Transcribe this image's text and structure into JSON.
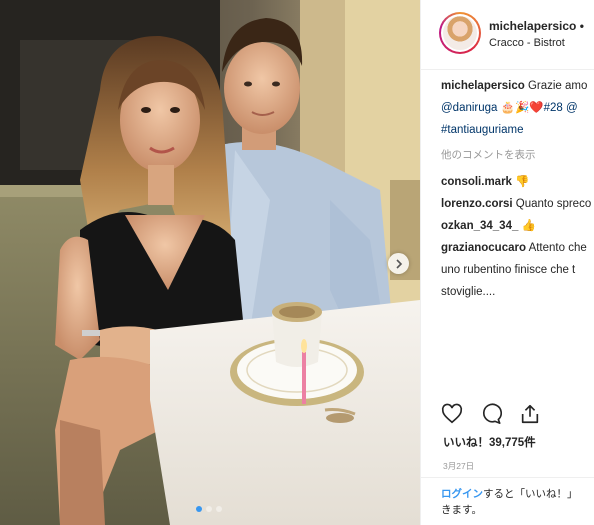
{
  "post": {
    "username": "michelapersico",
    "follow_dot": "•",
    "location": "Cracco - Bistrot",
    "caption_user": "michelapersico",
    "caption_text": "Grazie amo",
    "caption_line2": "@daniruga 🎂🎉❤️#28 @",
    "caption_line3": "#tantiauguriame",
    "more_comments": "他のコメントを表示",
    "comments": [
      {
        "user": "consoli.mark",
        "text": "👎"
      },
      {
        "user": "lorenzo.corsi",
        "text": "Quanto spreco"
      },
      {
        "user": "ozkan_34_34_",
        "text": "👍"
      },
      {
        "user": "grazianocucaro",
        "text": "Attento che",
        "text2": "uno rubentino finisce che t",
        "text3": "stoviglie...."
      }
    ],
    "likes": "いいね！39,775件",
    "date": "3月27日",
    "login_link": "ログイン",
    "login_text": "すると「いいね！」",
    "login_text2": "きます。"
  },
  "icons": {
    "like": "heart-icon",
    "comment": "comment-icon",
    "share": "share-icon",
    "carousel_next": "chevron-right-icon"
  },
  "carousel": {
    "count": 3,
    "active": 0
  },
  "colors": {
    "link": "#003569",
    "accent": "#3897f0",
    "muted": "#999999"
  }
}
